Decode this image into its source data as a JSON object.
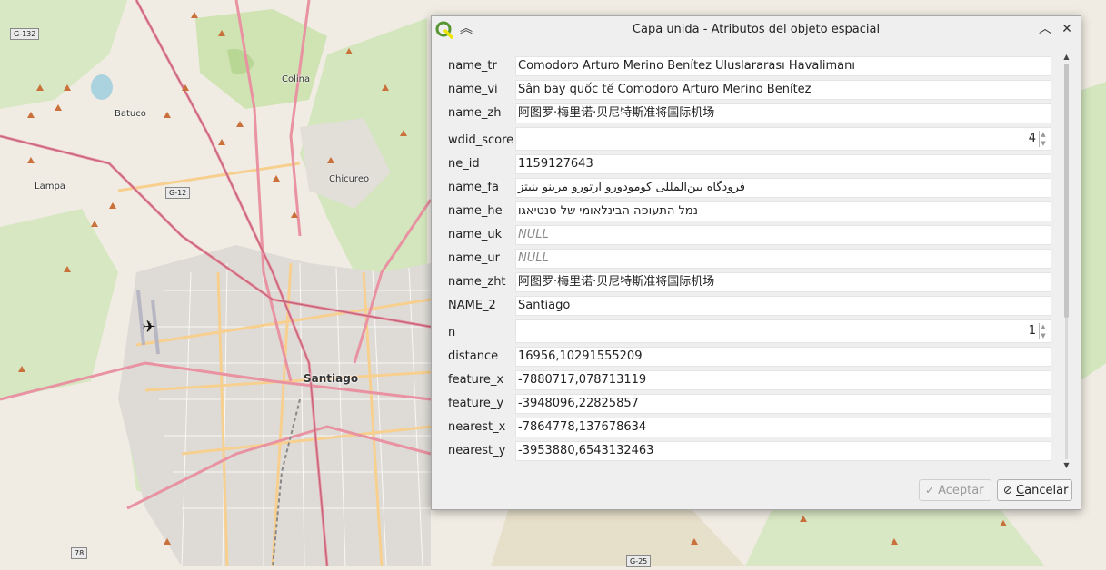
{
  "map": {
    "labels": [
      {
        "text": "Colina",
        "big": false
      },
      {
        "text": "Batuco",
        "big": false
      },
      {
        "text": "Lampa",
        "big": false
      },
      {
        "text": "Chicureo",
        "big": false
      },
      {
        "text": "Santiago",
        "big": true
      }
    ],
    "shields": [
      "G-132",
      "G-12",
      "78",
      "G-25"
    ],
    "airport_icon": "airplane-icon"
  },
  "dialog": {
    "title": "Capa unida - Atributos del objeto espacial",
    "app_icon": "qgis-logo-icon",
    "collapse_icon": "double-chevron-up-icon",
    "minimize_icon": "chevron-up-icon",
    "close_icon": "close-icon",
    "fields": [
      {
        "label": "name_tr",
        "value": "Comodoro Arturo Merino Benítez Uluslararası Havalimanı",
        "kind": "text"
      },
      {
        "label": "name_vi",
        "value": "Sân bay quốc tế Comodoro Arturo Merino Benítez",
        "kind": "text"
      },
      {
        "label": "name_zh",
        "value": "阿图罗·梅里诺·贝尼特斯准将国际机场",
        "kind": "text"
      },
      {
        "label": "wdid_score",
        "value": "4",
        "kind": "spin"
      },
      {
        "label": "ne_id",
        "value": "1159127643",
        "kind": "text"
      },
      {
        "label": "name_fa",
        "value": "فرودگاه بین‌المللی کومودورو ارتورو مرینو بنیتز",
        "kind": "rtl"
      },
      {
        "label": "name_he",
        "value": "נמל התעופה הבינלאומי של סנטיאגו",
        "kind": "rtl"
      },
      {
        "label": "name_uk",
        "value": "NULL",
        "kind": "null"
      },
      {
        "label": "name_ur",
        "value": "NULL",
        "kind": "null"
      },
      {
        "label": "name_zht",
        "value": "阿图罗·梅里诺·贝尼特斯准将国际机场",
        "kind": "text"
      },
      {
        "label": "NAME_2",
        "value": "Santiago",
        "kind": "text"
      },
      {
        "label": "n",
        "value": "1",
        "kind": "spin"
      },
      {
        "label": "distance",
        "value": "16956,10291555209",
        "kind": "text"
      },
      {
        "label": "feature_x",
        "value": "-7880717,078713119",
        "kind": "text"
      },
      {
        "label": "feature_y",
        "value": "-3948096,22825857",
        "kind": "text"
      },
      {
        "label": "nearest_x",
        "value": "-7864778,137678634",
        "kind": "text"
      },
      {
        "label": "nearest_y",
        "value": "-3953880,6543132463",
        "kind": "text"
      }
    ],
    "buttons": {
      "accept": {
        "label": "Aceptar",
        "enabled": false,
        "icon": "check-icon"
      },
      "cancel": {
        "label": "Cancelar",
        "enabled": true,
        "icon": "cancel-circle-icon"
      }
    }
  },
  "colors": {
    "map_bg": "#f0ece3",
    "urban": "#dedbd6",
    "green": "#cde6b0",
    "major_road": "#e892a2",
    "secondary_road": "#f7cf8f",
    "qgis_green": "#589632",
    "qgis_yellow": "#eee600"
  }
}
